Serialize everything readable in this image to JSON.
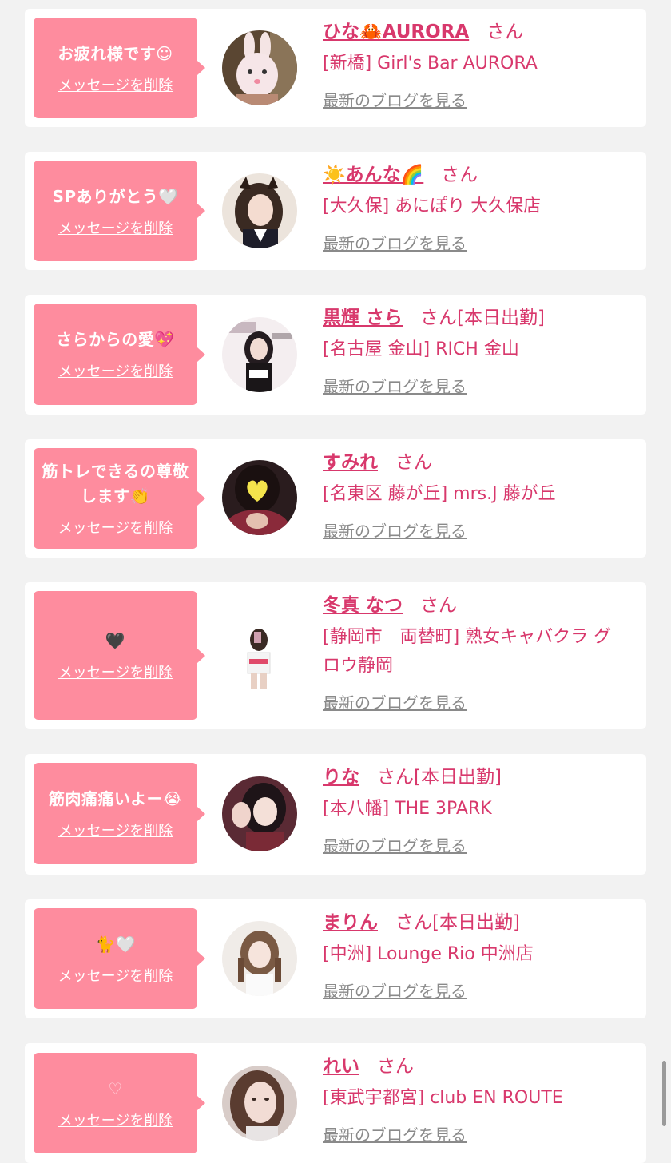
{
  "delete_label": "メッセージを削除",
  "san_label": "さん",
  "blog_label": "最新のブログを見る",
  "colors": {
    "bubble": "#fe8c9e",
    "accent": "#d8386c",
    "link_gray": "#8a8a8a",
    "background": "#f2f2f2"
  },
  "cards": [
    {
      "message": "お疲れ様です☺",
      "name": "ひな🦀AURORA",
      "status": "",
      "shop": "[新橋] Girl's Bar AURORA",
      "avatar": "avatar-bunny-filter-photo"
    },
    {
      "message": "SPありがとう🤍",
      "name": "☀️あんな🌈",
      "status": "",
      "shop": "[大久保] あにぽり 大久保店",
      "avatar": "avatar-cat-ear-photo"
    },
    {
      "message": "さらからの愛💖",
      "name": "黒輝 さら",
      "status": "[本日出勤]",
      "shop": "[名古屋 金山] RICH 金山",
      "avatar": "avatar-magazine-cover-photo"
    },
    {
      "message": "筋トレできるの尊敬します👏",
      "name": "すみれ",
      "status": "",
      "shop": "[名東区 藤が丘] mrs.J 藤が丘",
      "avatar": "avatar-heart-sticker-photo"
    },
    {
      "message": "🖤",
      "name": "冬真 なつ",
      "status": "",
      "shop": "[静岡市　両替町] 熟女キャバクラ グロウ静岡",
      "avatar": "avatar-mirror-selfie-photo"
    },
    {
      "message": "筋肉痛痛いよー😭",
      "name": "りな",
      "status": "[本日出勤]",
      "shop": "[本八幡] THE 3PARK",
      "avatar": "avatar-waving-photo"
    },
    {
      "message": "🐈🤍",
      "name": "まりん",
      "status": "[本日出勤]",
      "shop": "[中洲] Lounge Rio 中洲店",
      "avatar": "avatar-portrait-photo"
    },
    {
      "message": "♡",
      "name": "れい",
      "status": "",
      "shop": "[東武宇都宮] club EN ROUTE",
      "avatar": "avatar-closeup-photo"
    }
  ]
}
